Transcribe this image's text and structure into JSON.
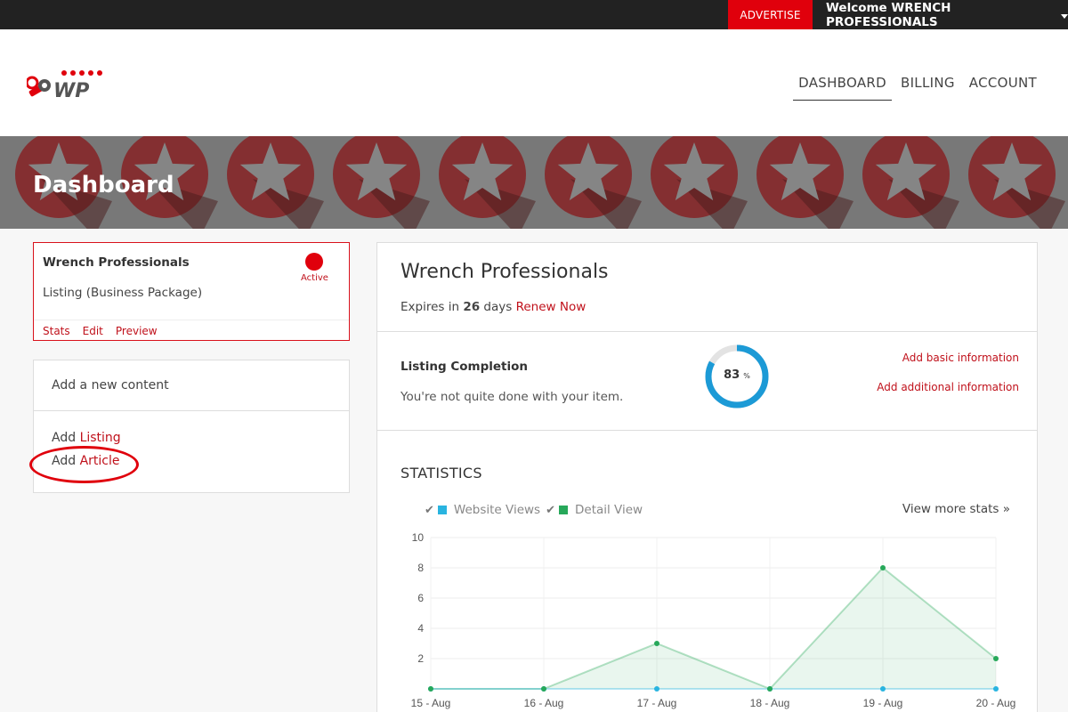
{
  "topbar": {
    "advertise_label": "ADVERTISE",
    "welcome_text": "Welcome WRENCH PROFESSIONALS"
  },
  "header": {
    "logo_text": "WP",
    "nav": [
      {
        "label": "DASHBOARD",
        "active": true
      },
      {
        "label": "BILLING",
        "active": false
      },
      {
        "label": "ACCOUNT",
        "active": false
      }
    ]
  },
  "banner": {
    "title": "Dashboard"
  },
  "listing_card": {
    "name": "Wrench Professionals",
    "type": "Listing (Business Package)",
    "status": "Active",
    "status_color": "#e0000c",
    "links": [
      "Stats",
      "Edit",
      "Preview"
    ]
  },
  "content_box": {
    "heading": "Add a new content",
    "add_prefix": "Add",
    "items": [
      "Listing",
      "Article"
    ]
  },
  "panel": {
    "title": "Wrench Professionals",
    "expires_prefix": "Expires in",
    "expires_days": "26",
    "expires_suffix": "days",
    "renew_label": "Renew Now",
    "completion_title": "Listing Completion",
    "completion_subtitle": "You're not quite done with your item.",
    "completion_percent": 83,
    "completion_percent_symbol": "%",
    "link_basic": "Add basic information",
    "link_additional": "Add additional information",
    "stats_title": "STATISTICS",
    "view_more_label": "View more stats »"
  },
  "colors": {
    "accent_red": "#c0111b",
    "gauge_blue": "#1c9ad6",
    "website_views": "#29b4e0",
    "detail_view": "#27a85a"
  },
  "chart_data": {
    "type": "area",
    "categories": [
      "15 - Aug",
      "16 - Aug",
      "17 - Aug",
      "18 - Aug",
      "19 - Aug",
      "20 - Aug"
    ],
    "series": [
      {
        "name": "Website Views",
        "values": [
          0,
          0,
          0,
          0,
          0,
          0
        ],
        "color": "#29b4e0"
      },
      {
        "name": "Detail View",
        "values": [
          0,
          0,
          3,
          0,
          8,
          2
        ],
        "color": "#27a85a"
      }
    ],
    "ylim": [
      0,
      10
    ],
    "yticks": [
      2,
      4,
      6,
      8,
      10
    ],
    "grid": true
  }
}
